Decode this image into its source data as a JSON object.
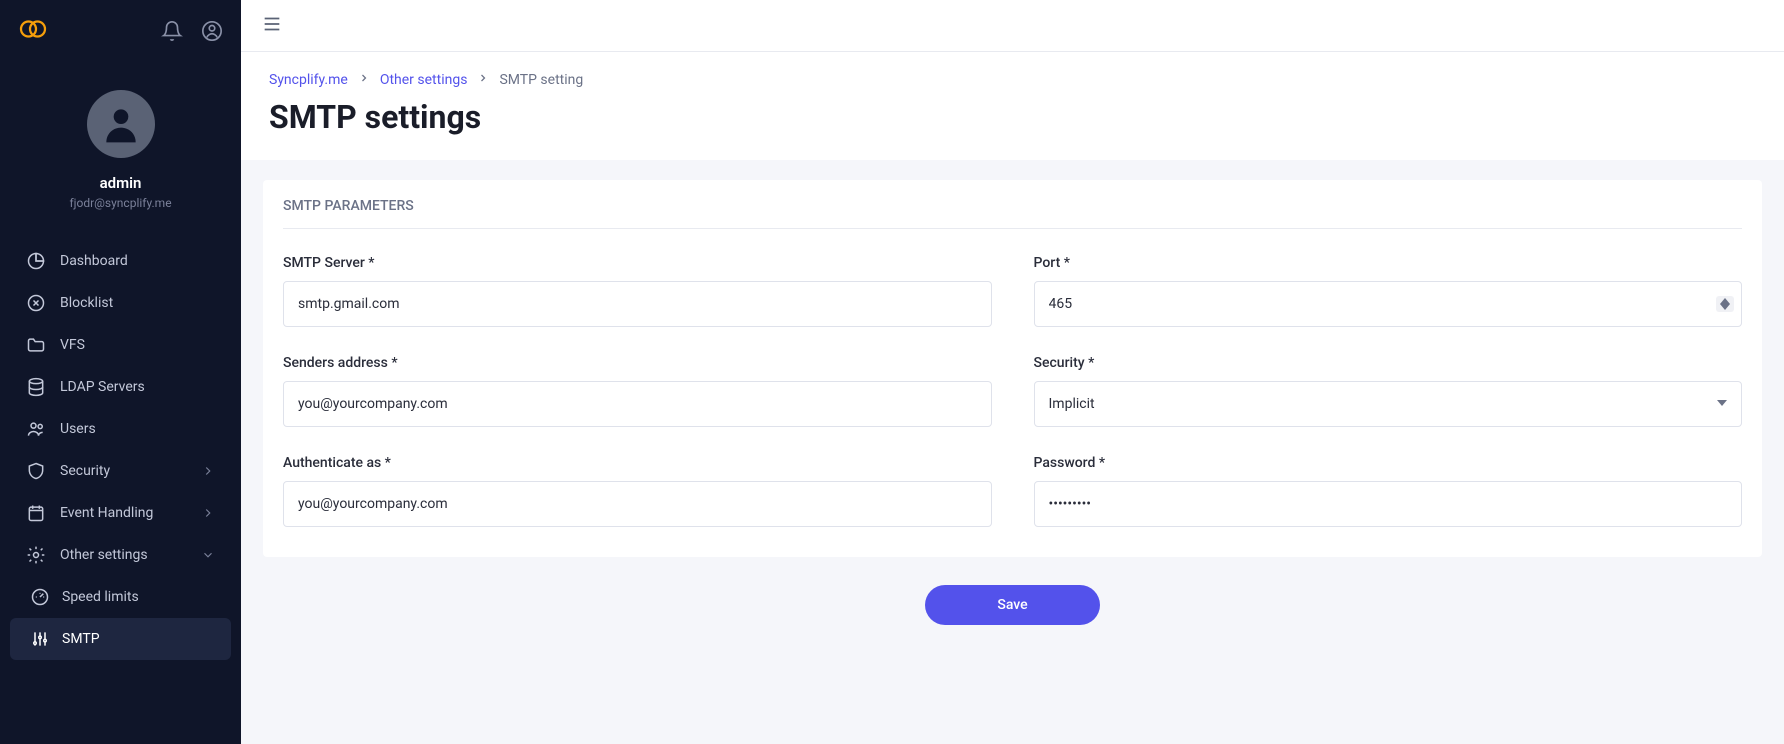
{
  "user": {
    "name": "admin",
    "email": "fjodr@syncplify.me"
  },
  "nav": {
    "dashboard": "Dashboard",
    "blocklist": "Blocklist",
    "vfs": "VFS",
    "ldap": "LDAP Servers",
    "users": "Users",
    "security": "Security",
    "event_handling": "Event Handling",
    "other_settings": "Other settings",
    "speed_limits": "Speed limits",
    "smtp": "SMTP"
  },
  "breadcrumb": {
    "root": "Syncplify.me",
    "section": "Other settings",
    "current": "SMTP setting"
  },
  "page": {
    "title": "SMTP settings",
    "section_title": "SMTP PARAMETERS"
  },
  "form": {
    "smtp_server": {
      "label": "SMTP Server *",
      "value": "smtp.gmail.com"
    },
    "port": {
      "label": "Port *",
      "value": "465"
    },
    "senders_address": {
      "label": "Senders address *",
      "value": "you@yourcompany.com"
    },
    "security": {
      "label": "Security *",
      "value": "Implicit"
    },
    "authenticate_as": {
      "label": "Authenticate as *",
      "value": "you@yourcompany.com"
    },
    "password": {
      "label": "Password *",
      "value": "•••••••••"
    }
  },
  "actions": {
    "save": "Save"
  }
}
